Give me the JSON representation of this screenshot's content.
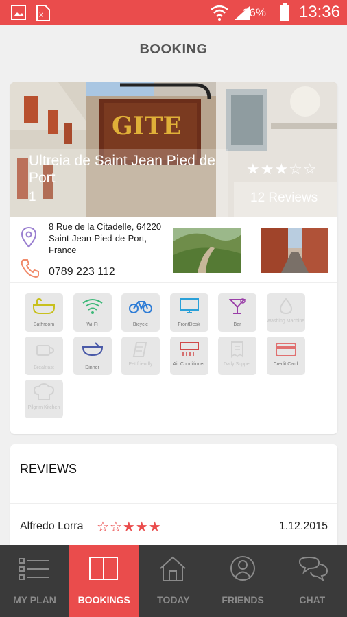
{
  "status_bar": {
    "battery": "26%",
    "time": "13:36"
  },
  "header": {
    "title": "BOOKING"
  },
  "hotel": {
    "name": "Ultreia de Saint Jean Pied de Port",
    "number": "1",
    "rating_stars": "★★★☆☆",
    "reviews_count": "12 Reviews",
    "address": "8 Rue de la Citadelle, 64220 Saint-Jean-Pied-de-Port, France",
    "phone": "0789 223 112",
    "sign_text": "GITE"
  },
  "amenities": [
    {
      "label": "Bathroom",
      "icon": "bathtub-icon",
      "active": true,
      "color": "#c8c01e"
    },
    {
      "label": "Wi-Fi",
      "icon": "wifi-icon",
      "active": true,
      "color": "#3cb878"
    },
    {
      "label": "Bicycle",
      "icon": "bicycle-icon",
      "active": true,
      "color": "#2f7dd6"
    },
    {
      "label": "FrontDesk",
      "icon": "monitor-icon",
      "active": true,
      "color": "#2aa0d8"
    },
    {
      "label": "Bar",
      "icon": "cocktail-icon",
      "active": true,
      "color": "#9a3fa8"
    },
    {
      "label": "Washing Machine",
      "icon": "drop-icon",
      "active": false
    },
    {
      "label": "Breakfast",
      "icon": "cup-icon",
      "active": false
    },
    {
      "label": "Dinner",
      "icon": "bowl-icon",
      "active": true,
      "color": "#4a5aa8"
    },
    {
      "label": "Pet friendly",
      "icon": "pet-icon",
      "active": false
    },
    {
      "label": "Air Conditioner",
      "icon": "aircon-icon",
      "active": true,
      "color": "#d04848"
    },
    {
      "label": "Daily Supper",
      "icon": "receipt-icon",
      "active": false
    },
    {
      "label": "Credit Card",
      "icon": "creditcard-icon",
      "active": true,
      "color": "#e07070"
    },
    {
      "label": "Pilgrim Kitchen",
      "icon": "chef-hat-icon",
      "active": false
    }
  ],
  "reviews": {
    "title": "REVIEWS",
    "items": [
      {
        "name": "Alfredo Lorra",
        "stars": "☆☆★★★",
        "date": "1.12.2015"
      }
    ]
  },
  "nav": [
    {
      "label": "MY PLAN",
      "icon": "list-icon",
      "active": false
    },
    {
      "label": "BOOKINGS",
      "icon": "book-icon",
      "active": true
    },
    {
      "label": "TODAY",
      "icon": "home-icon",
      "active": false
    },
    {
      "label": "FRIENDS",
      "icon": "person-icon",
      "active": false
    },
    {
      "label": "CHAT",
      "icon": "chat-bubble-icon",
      "active": false
    }
  ],
  "colors": {
    "accent": "#ea4c4c",
    "nav_bg": "#3a3a3a"
  }
}
